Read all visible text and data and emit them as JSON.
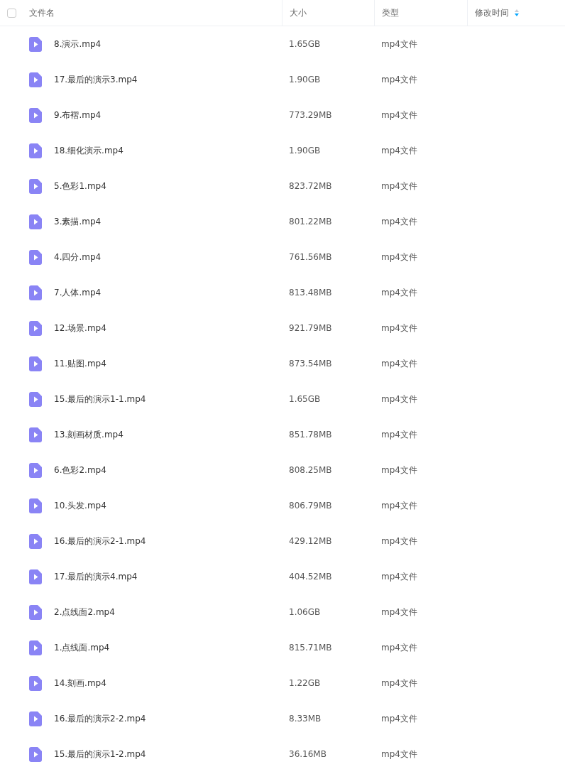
{
  "header": {
    "select_all": {
      "checked": false
    },
    "columns": [
      {
        "label": "文件名",
        "sorted": false
      },
      {
        "label": "大小",
        "sorted": false
      },
      {
        "label": "类型",
        "sorted": false
      },
      {
        "label": "修改时间",
        "sorted": true
      }
    ]
  },
  "rows": [
    {
      "name": "8.演示.mp4",
      "size": "1.65GB",
      "type": "mp4文件"
    },
    {
      "name": "17.最后的演示3.mp4",
      "size": "1.90GB",
      "type": "mp4文件"
    },
    {
      "name": "9.布褶.mp4",
      "size": "773.29MB",
      "type": "mp4文件"
    },
    {
      "name": "18.细化演示.mp4",
      "size": "1.90GB",
      "type": "mp4文件"
    },
    {
      "name": "5.色彩1.mp4",
      "size": "823.72MB",
      "type": "mp4文件"
    },
    {
      "name": "3.素描.mp4",
      "size": "801.22MB",
      "type": "mp4文件"
    },
    {
      "name": "4.四分.mp4",
      "size": "761.56MB",
      "type": "mp4文件"
    },
    {
      "name": "7.人体.mp4",
      "size": "813.48MB",
      "type": "mp4文件"
    },
    {
      "name": "12.场景.mp4",
      "size": "921.79MB",
      "type": "mp4文件"
    },
    {
      "name": "11.贴图.mp4",
      "size": "873.54MB",
      "type": "mp4文件"
    },
    {
      "name": "15.最后的演示1-1.mp4",
      "size": "1.65GB",
      "type": "mp4文件"
    },
    {
      "name": "13.刻画材质.mp4",
      "size": "851.78MB",
      "type": "mp4文件"
    },
    {
      "name": "6.色彩2.mp4",
      "size": "808.25MB",
      "type": "mp4文件"
    },
    {
      "name": "10.头发.mp4",
      "size": "806.79MB",
      "type": "mp4文件"
    },
    {
      "name": "16.最后的演示2-1.mp4",
      "size": "429.12MB",
      "type": "mp4文件"
    },
    {
      "name": "17.最后的演示4.mp4",
      "size": "404.52MB",
      "type": "mp4文件"
    },
    {
      "name": "2.点线面2.mp4",
      "size": "1.06GB",
      "type": "mp4文件"
    },
    {
      "name": "1.点线面.mp4",
      "size": "815.71MB",
      "type": "mp4文件"
    },
    {
      "name": "14.刻画.mp4",
      "size": "1.22GB",
      "type": "mp4文件"
    },
    {
      "name": "16.最后的演示2-2.mp4",
      "size": "8.33MB",
      "type": "mp4文件"
    },
    {
      "name": "15.最后的演示1-2.mp4",
      "size": "36.16MB",
      "type": "mp4文件"
    }
  ]
}
